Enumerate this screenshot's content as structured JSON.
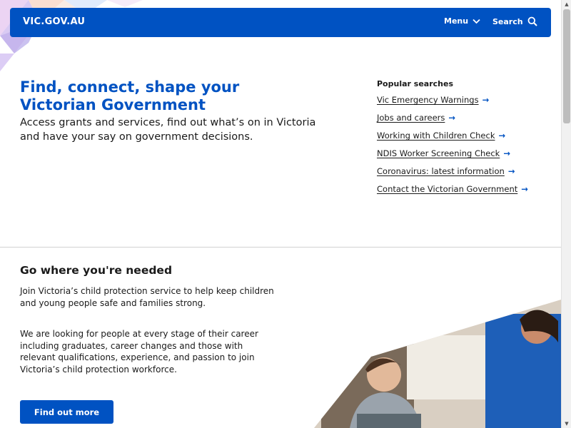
{
  "header": {
    "logo": "VIC.GOV.AU",
    "menu_label": "Menu",
    "search_label": "Search",
    "menu_icon": "chevron-down-icon",
    "search_icon": "search-icon"
  },
  "hero": {
    "title": "Find, connect, shape your Victorian Government",
    "intro": "Access grants and services, find out what’s on in Victoria and have your say on government decisions."
  },
  "popular": {
    "heading": "Popular searches",
    "arrow_icon": "arrow-right-icon",
    "links": [
      {
        "label": "Vic Emergency Warnings"
      },
      {
        "label": "Jobs and careers"
      },
      {
        "label": "Working with Children Check"
      },
      {
        "label": "NDIS Worker Screening Check"
      },
      {
        "label": "Coronavirus: latest information"
      },
      {
        "label": "Contact the Victorian Government"
      }
    ]
  },
  "feature": {
    "title": "Go where you're needed",
    "para1": "Join Victoria’s child protection service to help keep children and young people safe and families strong.",
    "para2": "We are looking for people at every stage of their career including graduates, career changes and those with relevant qualifications, experience, and passion to join Victoria’s child protection workforce.",
    "button": "Find out more"
  },
  "colors": {
    "brand_blue": "#0052c2",
    "text": "#1a1a1a",
    "divider": "#d2d2d2"
  }
}
